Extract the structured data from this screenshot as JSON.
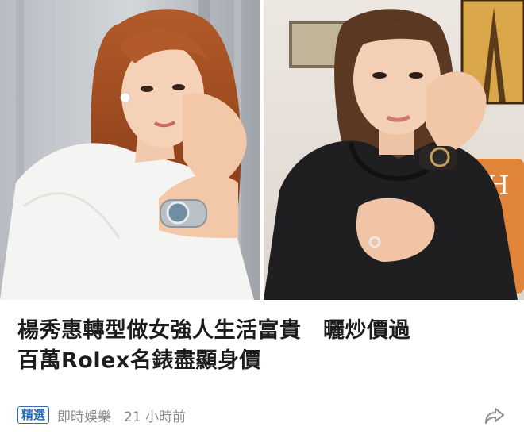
{
  "article": {
    "headline_line1": "楊秀惠轉型做女強人生活富貴　曬炒價過",
    "headline_line2": "百萬Rolex名錶盡顯身價",
    "badge": "精選",
    "source": "即時娛樂",
    "time": "21 小時前"
  },
  "icons": {
    "share": "share-icon"
  },
  "colors": {
    "badge": "#2b6cb0",
    "headline": "#1d1d1d",
    "meta": "#8a8a8a"
  }
}
